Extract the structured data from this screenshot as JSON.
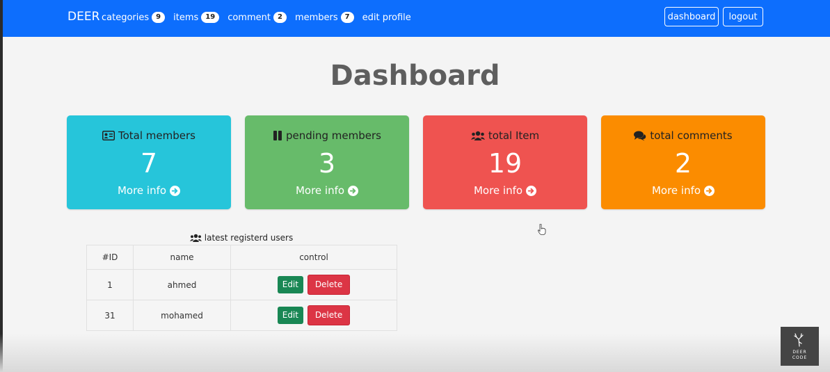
{
  "nav": {
    "brand": "DEER",
    "links": [
      {
        "label": "categories",
        "badge": "9"
      },
      {
        "label": "items",
        "badge": "19"
      },
      {
        "label": "comment",
        "badge": "2"
      },
      {
        "label": "members",
        "badge": "7"
      },
      {
        "label": "edit profile"
      }
    ],
    "dashboard_label": "dashboard",
    "logout_label": "logout"
  },
  "page": {
    "title": "Dashboard"
  },
  "stats": [
    {
      "title": "Total members",
      "value": "7",
      "more": "More info",
      "icon": "id-card-icon",
      "color": "#26c5da"
    },
    {
      "title": "pending members",
      "value": "3",
      "more": "More info",
      "icon": "pause-icon",
      "color": "#67bb6a"
    },
    {
      "title": "total Item",
      "value": "19",
      "more": "More info",
      "icon": "users-icon",
      "color": "#ef5350"
    },
    {
      "title": "total comments",
      "value": "2",
      "more": "More info",
      "icon": "comments-icon",
      "color": "#fb8c00"
    }
  ],
  "latest": {
    "caption": "latest registerd users",
    "headers": [
      "#ID",
      "name",
      "control"
    ],
    "rows": [
      {
        "id": "1",
        "name": "ahmed",
        "edit": "Edit",
        "delete": "Delete"
      },
      {
        "id": "31",
        "name": "mohamed",
        "edit": "Edit",
        "delete": "Delete"
      }
    ]
  },
  "watermark": {
    "line1": "DEER",
    "line2": "CODE"
  }
}
